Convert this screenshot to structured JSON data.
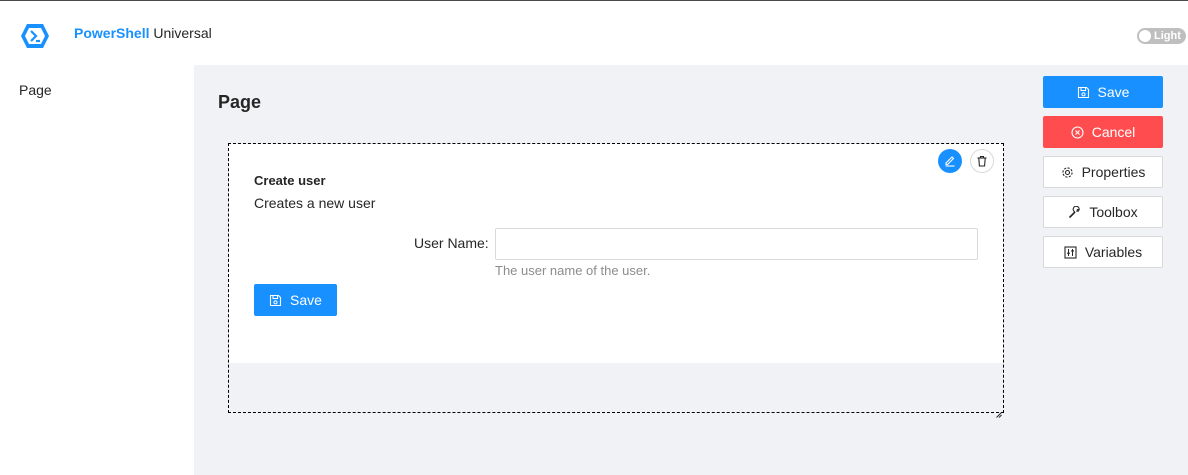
{
  "header": {
    "brand_bold": "PowerShell",
    "brand_rest": " Universal",
    "theme_label": "Light"
  },
  "sidebar": {
    "items": [
      {
        "label": "Page"
      }
    ]
  },
  "main": {
    "page_title": "Page",
    "component": {
      "title": "Create user",
      "description": "Creates a new user",
      "field": {
        "label": "User Name",
        "value": "",
        "help": "The user name of the user."
      },
      "submit_label": "Save"
    }
  },
  "actions": {
    "save": "Save",
    "cancel": "Cancel",
    "properties": "Properties",
    "toolbox": "Toolbox",
    "variables": "Variables"
  },
  "colors": {
    "primary": "#1890ff",
    "danger": "#ff4d4f",
    "content_bg": "#f0f2f5"
  },
  "icons": [
    "powershell-logo-icon",
    "edit-icon",
    "delete-icon",
    "save-icon",
    "cancel-icon",
    "gear-icon",
    "wrench-icon",
    "sliders-icon"
  ]
}
